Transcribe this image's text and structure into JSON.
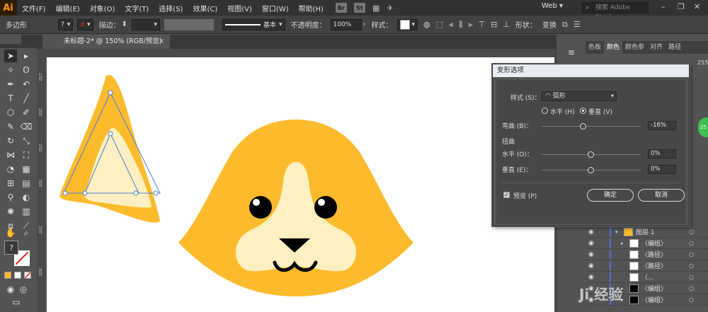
{
  "app": {
    "logo": "Ai"
  },
  "menu": {
    "items": [
      "文件(F)",
      "编辑(E)",
      "对象(O)",
      "文字(T)",
      "选择(S)",
      "效果(C)",
      "视图(V)",
      "窗口(W)",
      "帮助(H)"
    ],
    "badges": [
      "Br",
      "St"
    ],
    "workspace": "Web ▾",
    "stock_placeholder": "搜索 Adobe Stock",
    "window_buttons": [
      "–",
      "❐",
      "✕"
    ]
  },
  "controlbar": {
    "tool_name": "多边形",
    "fill_value": "?",
    "stroke_label": "描边：",
    "stroke_style": "基本",
    "opacity_label": "不透明度：",
    "opacity_value": "100%",
    "style_label": "样式：",
    "shape_label": "形状：",
    "transform_label": "变换"
  },
  "document": {
    "tab_title": "未标题-2* @ 150% (RGB/预览)",
    "tab_close": "×"
  },
  "ruler_left_numbers": [
    "150",
    "200",
    "250",
    "300",
    "350",
    "400"
  ],
  "tools": {
    "fill_indicator": "?"
  },
  "panels": {
    "tabs": [
      "色板",
      "颜色",
      "颜色参",
      "对齐",
      "路径"
    ],
    "active_tab": "颜色",
    "color_value": "255",
    "layers": [
      {
        "name": "图层 1",
        "indent": 0,
        "arrow": "▾"
      },
      {
        "name": "〈编组〉",
        "indent": 1,
        "arrow": "▸"
      },
      {
        "name": "〈路径〉",
        "indent": 1,
        "arrow": ""
      },
      {
        "name": "〈路径〉",
        "indent": 1,
        "arrow": ""
      },
      {
        "name": "〈...",
        "indent": 1,
        "arrow": ""
      },
      {
        "name": "〈编组〉",
        "indent": 1,
        "arrow": "▸"
      },
      {
        "name": "〈编组〉",
        "indent": 1,
        "arrow": "▸"
      }
    ]
  },
  "dialog": {
    "title": "变形选项",
    "style_label": "样式 (S)：",
    "style_value": "弧形",
    "horizontal_label": "水平 (H)",
    "vertical_label": "垂直 (V)",
    "orientation": "vertical",
    "bend_label": "弯曲 (B)：",
    "bend_value": "-16%",
    "bend_fraction": 0.42,
    "distortion_heading": "扭曲",
    "dist_h_label": "水平 (O)：",
    "dist_h_value": "0%",
    "dist_h_fraction": 0.5,
    "dist_v_label": "垂直 (E)：",
    "dist_v_value": "0%",
    "dist_v_fraction": 0.5,
    "preview_label": "预览 (P)",
    "preview_checked": true,
    "ok_label": "确定",
    "cancel_label": "取消"
  },
  "badge_text": "25",
  "watermark": "Ji 经验",
  "colors": {
    "dog_orange": "#fbbb2c",
    "dog_cream": "#fef0c0",
    "dog_dark": "#000000",
    "selection_blue": "#4f7bd8"
  }
}
